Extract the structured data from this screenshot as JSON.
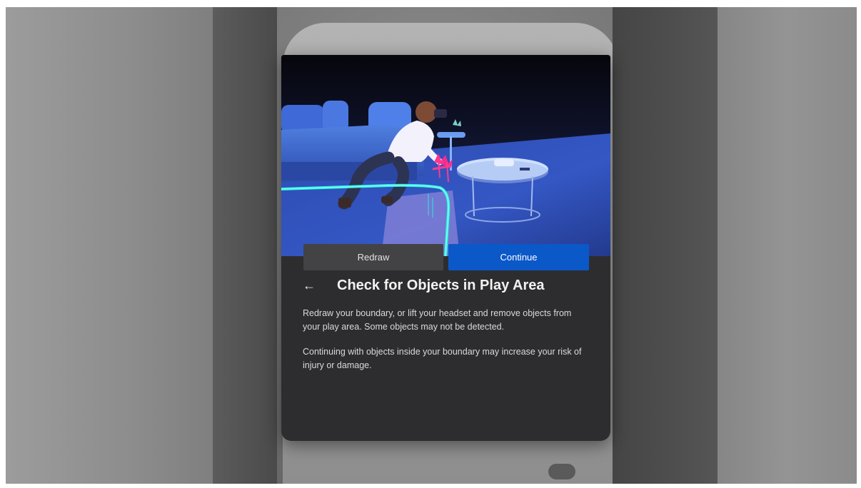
{
  "dialog": {
    "back_icon": "←",
    "title": "Check for Objects in Play Area",
    "paragraphs": [
      "Redraw your boundary, or lift your headset and remove objects from your play area. Some objects may not be detected.",
      "Continuing with objects inside your boundary may increase your risk of injury or damage."
    ],
    "buttons": {
      "redraw": "Redraw",
      "continue": "Continue"
    }
  },
  "colors": {
    "panel_bg": "#2d2d2f",
    "primary_button": "#0b58c9",
    "secondary_button": "#434346",
    "boundary_line": "#2ef0e0"
  },
  "icons": {
    "back": "arrow-left-icon"
  }
}
